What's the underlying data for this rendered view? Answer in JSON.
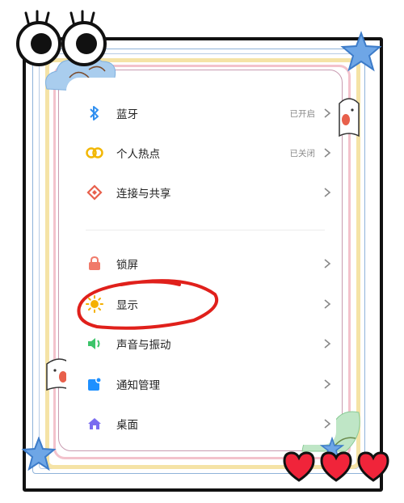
{
  "settings": {
    "rows": [
      {
        "label": "蓝牙",
        "status": "已开启",
        "icon": "bluetooth-icon"
      },
      {
        "label": "个人热点",
        "status": "已关闭",
        "icon": "hotspot-icon"
      },
      {
        "label": "连接与共享",
        "status": "",
        "icon": "share-connection-icon"
      },
      {
        "label": "锁屏",
        "status": "",
        "icon": "lock-icon"
      },
      {
        "label": "显示",
        "status": "",
        "icon": "sun-icon"
      },
      {
        "label": "声音与振动",
        "status": "",
        "icon": "speaker-icon"
      },
      {
        "label": "通知管理",
        "status": "",
        "icon": "notification-icon"
      },
      {
        "label": "桌面",
        "status": "",
        "icon": "home-icon"
      }
    ]
  },
  "colors": {
    "bluetooth": "#2f8ff0",
    "hotspot": "#f2b705",
    "share": "#e8604c",
    "lock": "#f07a6a",
    "sun": "#f5b000",
    "sound": "#3cc46a",
    "notification": "#1e90ff",
    "home": "#7a6cf0",
    "highlight_circle": "#e0201b"
  }
}
